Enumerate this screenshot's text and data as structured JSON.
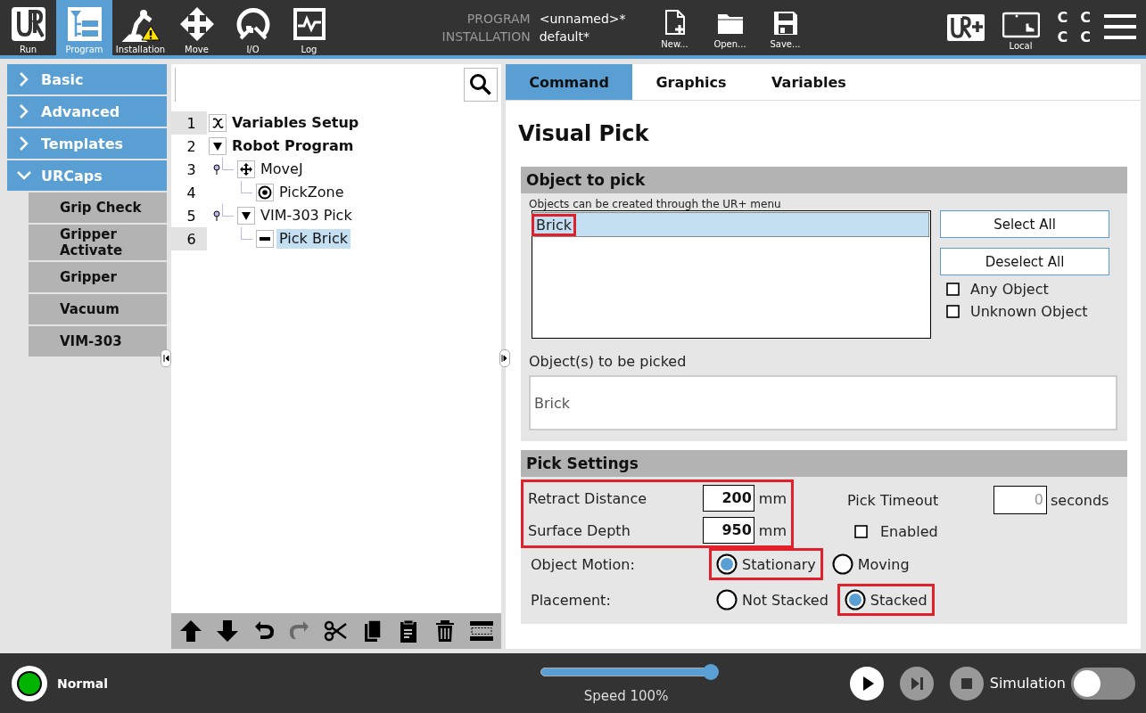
{
  "top_bar": {
    "nav": [
      {
        "label": "Run",
        "kind": "run",
        "selected": false
      },
      {
        "label": "Program",
        "kind": "program",
        "selected": true
      },
      {
        "label": "Installation",
        "kind": "installation",
        "selected": false
      },
      {
        "label": "Move",
        "kind": "move",
        "selected": false
      },
      {
        "label": "I/O",
        "kind": "io",
        "selected": false
      },
      {
        "label": "Log",
        "kind": "log",
        "selected": false
      }
    ],
    "program_label": "PROGRAM",
    "program_value": "<unnamed>*",
    "installation_label": "INSTALLATION",
    "installation_value": "default*",
    "file_buttons": [
      {
        "label": "New...",
        "kind": "new"
      },
      {
        "label": "Open...",
        "kind": "open"
      },
      {
        "label": "Save...",
        "kind": "save"
      }
    ],
    "local_label": "Local",
    "status_letters": [
      "C",
      "C",
      "C",
      "C"
    ]
  },
  "sidebar": {
    "items": [
      {
        "label": "Basic",
        "expanded": false
      },
      {
        "label": "Advanced",
        "expanded": false
      },
      {
        "label": "Templates",
        "expanded": false
      },
      {
        "label": "URCaps",
        "expanded": true,
        "children": [
          {
            "label": "Grip Check"
          },
          {
            "label": "Gripper Activate"
          },
          {
            "label": "Gripper"
          },
          {
            "label": "Vacuum"
          },
          {
            "label": "VIM-303"
          }
        ]
      }
    ]
  },
  "tree": {
    "nodes": [
      {
        "line": "1",
        "label": "Variables Setup",
        "kind": "variables",
        "marked": true,
        "selected": false
      },
      {
        "line": "2",
        "label": "Robot Program",
        "kind": "folder",
        "expanded": true,
        "marked": false,
        "selected": false,
        "children": [
          {
            "line": "3",
            "label": "MoveJ",
            "kind": "move",
            "marked": false,
            "selected": false,
            "children": [
              {
                "line": "4",
                "label": "PickZone",
                "kind": "waypoint",
                "marked": false,
                "selected": false
              }
            ]
          },
          {
            "line": "5",
            "label": "VIM-303 Pick",
            "kind": "folder",
            "expanded": true,
            "marked": false,
            "selected": false,
            "children": [
              {
                "line": "6",
                "label": "Pick Brick",
                "kind": "action",
                "marked": true,
                "selected": true
              }
            ]
          }
        ]
      }
    ],
    "toolbar": [
      {
        "kind": "up",
        "disabled": false
      },
      {
        "kind": "down",
        "disabled": false
      },
      {
        "kind": "undo",
        "disabled": false
      },
      {
        "kind": "redo",
        "disabled": true
      },
      {
        "kind": "cut",
        "disabled": false
      },
      {
        "kind": "copy",
        "disabled": false
      },
      {
        "kind": "paste",
        "disabled": false
      },
      {
        "kind": "delete",
        "disabled": false
      },
      {
        "kind": "suppress",
        "disabled": false
      }
    ]
  },
  "panel": {
    "tabs": [
      {
        "label": "Command",
        "selected": true
      },
      {
        "label": "Graphics",
        "selected": false
      },
      {
        "label": "Variables",
        "selected": false
      }
    ],
    "title": "Visual Pick",
    "object_section": {
      "title": "Object to pick",
      "hint": "Objects can be created through the UR+ menu",
      "objects": [
        {
          "label": "Brick",
          "selected": true,
          "highlighted": true
        }
      ],
      "buttons": [
        "Select All",
        "Deselect All"
      ],
      "checkboxes": [
        {
          "label": "Any Object",
          "checked": false
        },
        {
          "label": "Unknown Object",
          "checked": false
        }
      ],
      "picked_label": "Object(s) to be picked",
      "picked_value": "Brick"
    },
    "pick_settings": {
      "title": "Pick Settings",
      "distances_highlighted": true,
      "distances": [
        {
          "label": "Retract Distance",
          "value": "200",
          "unit": "mm"
        },
        {
          "label": "Surface Depth",
          "value": "950",
          "unit": "mm"
        }
      ],
      "timeout": {
        "label": "Pick Timeout",
        "value": "0",
        "unit": "seconds",
        "disabled": true
      },
      "enabled": {
        "label": "Enabled",
        "checked": false
      },
      "radio_groups": [
        {
          "label": "Object Motion:",
          "options": [
            {
              "label": "Stationary",
              "selected": true,
              "highlighted": true
            },
            {
              "label": "Moving",
              "selected": false,
              "highlighted": false
            }
          ]
        },
        {
          "label": "Placement:",
          "options": [
            {
              "label": "Not Stacked",
              "selected": false,
              "highlighted": false
            },
            {
              "label": "Stacked",
              "selected": true,
              "highlighted": true
            }
          ]
        }
      ]
    }
  },
  "bottom_bar": {
    "status": {
      "label": "Normal",
      "color": "#00b400"
    },
    "speed": {
      "level": 1.0,
      "label": "Speed 100%"
    },
    "controls": [
      {
        "kind": "play",
        "disabled": false
      },
      {
        "kind": "step",
        "disabled": true
      },
      {
        "kind": "stop",
        "disabled": true
      }
    ],
    "simulation": {
      "label": "Simulation",
      "on": false
    }
  }
}
